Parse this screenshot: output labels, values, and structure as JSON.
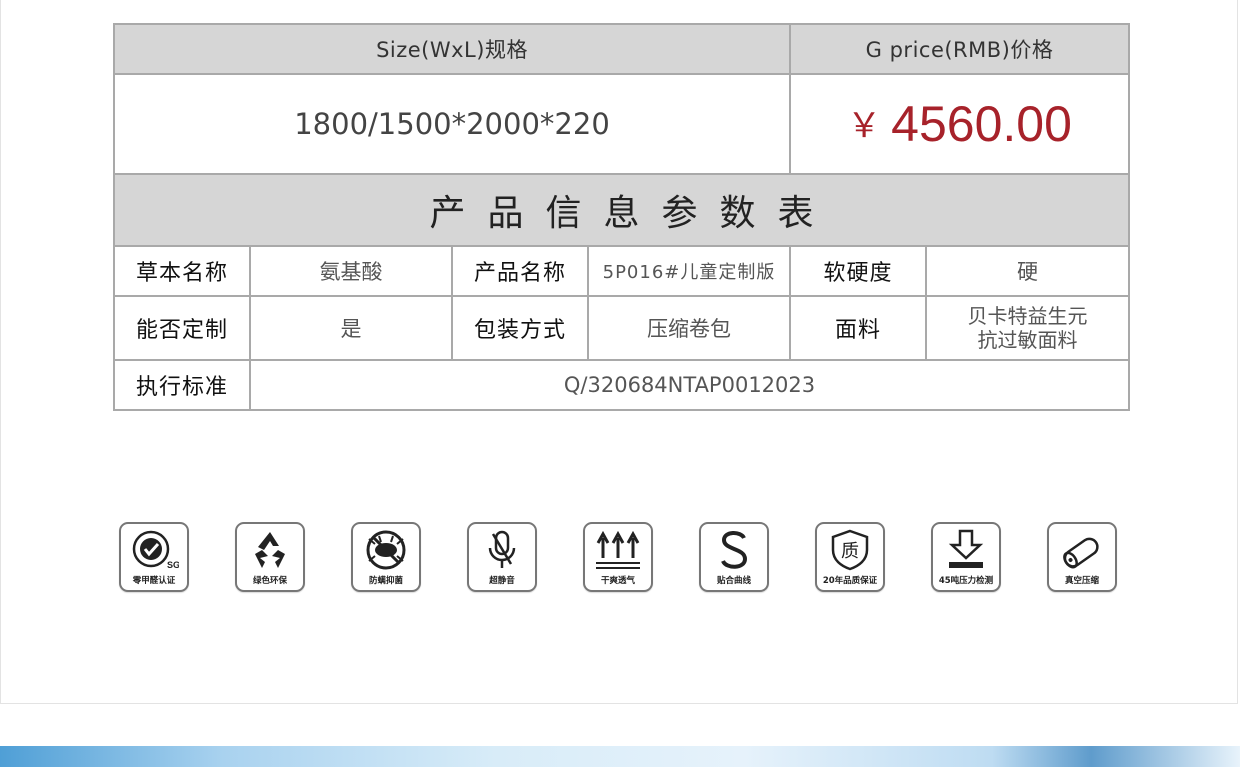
{
  "spec_table": {
    "size_header": "Size(WxL)规格",
    "price_header": "G price(RMB)价格",
    "size_value": "1800/1500*2000*220",
    "price_currency": "￥",
    "price_amount": "4560.00",
    "price_color": "#a7222a",
    "info_title": "产品信息参数表",
    "rows": [
      [
        {
          "label": "草本名称",
          "value": "氨基酸"
        },
        {
          "label": "产品名称",
          "value": "5P016#儿童定制版"
        },
        {
          "label": "软硬度",
          "value": "硬"
        }
      ],
      [
        {
          "label": "能否定制",
          "value": "是"
        },
        {
          "label": "包装方式",
          "value": "压缩卷包"
        },
        {
          "label": "面料",
          "value_lines": [
            "贝卡特益生元",
            "抗过敏面料"
          ]
        }
      ],
      [
        {
          "label": "执行标准",
          "value": "Q/320684NTAP0012023"
        }
      ]
    ]
  },
  "features": [
    {
      "icon": "sgs-certification-icon",
      "label": "零甲醛认证",
      "badge_text": "SGS"
    },
    {
      "icon": "recycle-icon",
      "label": "绿色环保"
    },
    {
      "icon": "no-mite-icon",
      "label": "防螨抑菌"
    },
    {
      "icon": "mute-microphone-icon",
      "label": "超静音"
    },
    {
      "icon": "breathable-arrows-icon",
      "label": "干爽透气"
    },
    {
      "icon": "s-curve-icon",
      "label": "贴合曲线"
    },
    {
      "icon": "quality-shield-icon",
      "label": "20年品质保证",
      "badge_text": "质"
    },
    {
      "icon": "pressure-test-icon",
      "label": "45吨压力检测"
    },
    {
      "icon": "vacuum-roll-icon",
      "label": "真空压缩"
    }
  ]
}
